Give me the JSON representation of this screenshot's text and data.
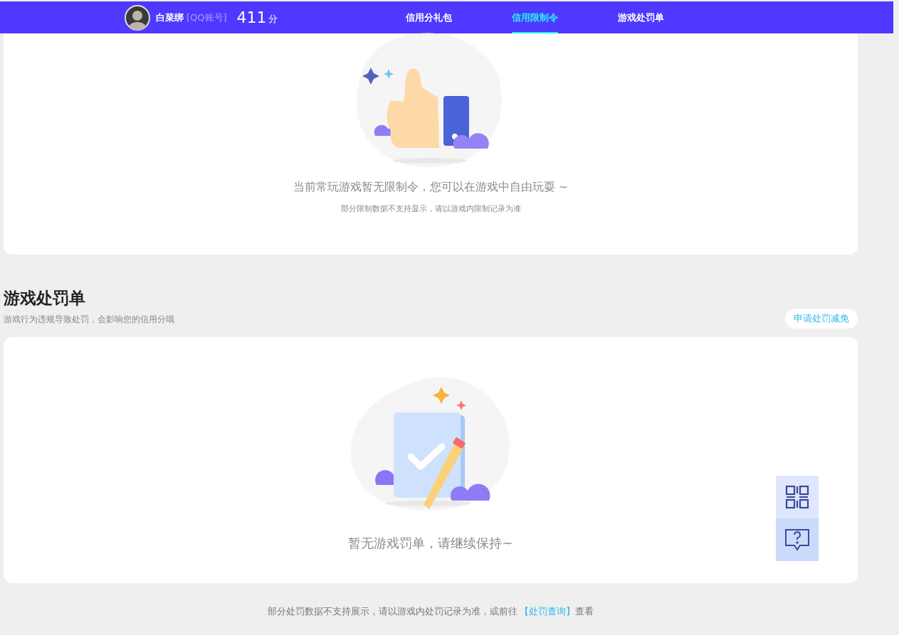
{
  "header": {
    "user_name": "白菜绑",
    "account_type": "[QQ账号]",
    "score": "411",
    "score_unit": "分"
  },
  "tabs": [
    {
      "label": "信用分礼包",
      "selected": false
    },
    {
      "label": "信用限制令",
      "selected": true
    },
    {
      "label": "游戏处罚单",
      "selected": false
    }
  ],
  "restriction_card": {
    "message": "当前常玩游戏暂无限制令，您可以在游戏中自由玩耍 ~",
    "note": "部分限制数据不支持显示，请以游戏内限制记录为准"
  },
  "penalty_section": {
    "title": "游戏处罚单",
    "subtitle": "游戏行为违规导致处罚，会影响您的信用分哦",
    "appeal_button": "申请处罚减免",
    "empty_message": "暂无游戏罚单，请继续保持~"
  },
  "footer": {
    "text": "部分处罚数据不支持展示，请以游戏内处罚记录为准，或前往 ",
    "link": "【处罚查询】",
    "suffix": "查看"
  }
}
